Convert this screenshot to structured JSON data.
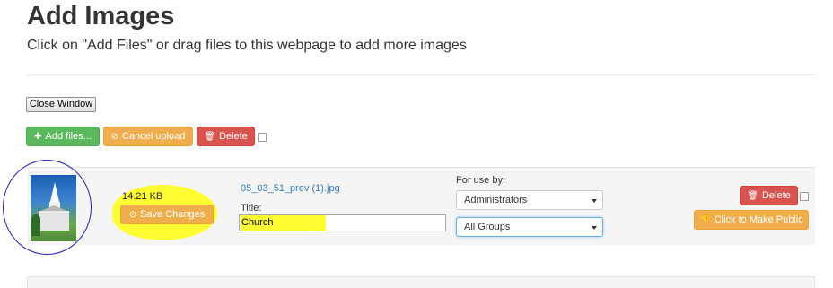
{
  "header": {
    "title": "Add Images",
    "subtitle": "Click on \"Add Files\" or drag files to this webpage to add more images"
  },
  "toolbar": {
    "close_window_label": "Close Window",
    "add_files_label": "Add files...",
    "cancel_upload_label": "Cancel upload",
    "delete_label": "Delete",
    "select_all_checked": false
  },
  "file_row": {
    "size": "14.21 KB",
    "save_label": "Save Changes",
    "filename": "05_03_51_prev (1).jpg",
    "title_label": "Title:",
    "title_value": "Church",
    "for_use_label": "For use by:",
    "audience_selected": "Administrators",
    "group_selected": "All Groups",
    "delete_label": "Delete",
    "make_public_label": "Click to Make Public",
    "row_checked": false
  },
  "colors": {
    "success": "#5cb85c",
    "warning": "#f0ad4e",
    "danger": "#d9534f",
    "link": "#337ab7",
    "highlight": "#ffff33",
    "annotation_circle": "#2323b4"
  },
  "icons": {
    "add": "plus-icon",
    "cancel": "ban-icon",
    "delete": "trash-icon",
    "save": "circle-icon",
    "make_public": "thumbs-down-icon"
  }
}
